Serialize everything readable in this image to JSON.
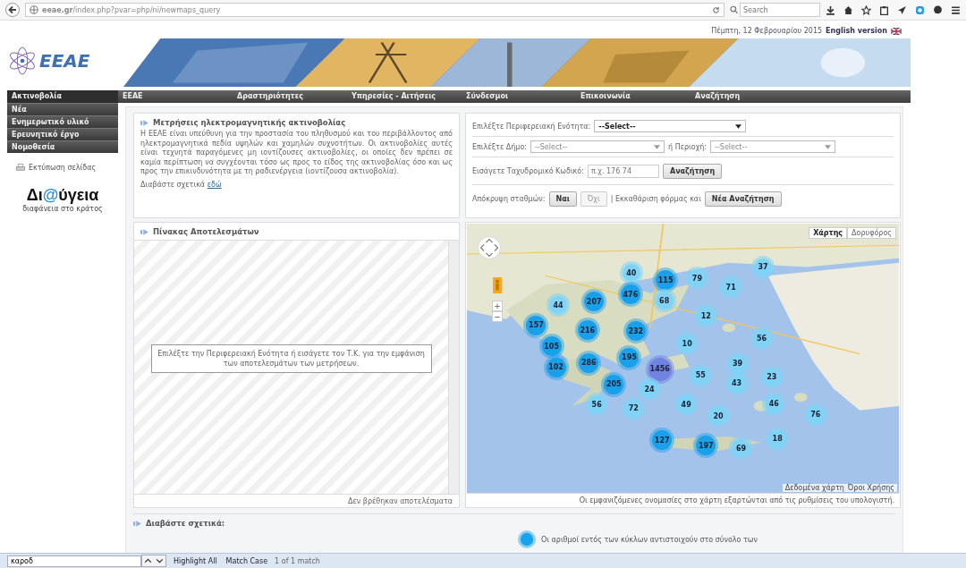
{
  "browser": {
    "url": "**eeae.gr**/index.php?pvar=php/ni/newmaps_query",
    "search_placeholder": "Search"
  },
  "header": {
    "logo": "ΕΕΑΕ",
    "date": "Πέμπτη, 12 Φεβρουαρίου 2015",
    "language_link": "English version"
  },
  "nav": [
    {
      "label": "Ακτινοβολία",
      "selected": true
    },
    {
      "label": "ΕΕΑΕ",
      "selected": false
    },
    {
      "label": "Δραστηριότητες",
      "selected": false
    },
    {
      "label": "Υπηρεσίες - Αιτήσεις",
      "selected": false
    },
    {
      "label": "Σύνδεσμοι",
      "selected": false
    },
    {
      "label": "Επικοινωνία",
      "selected": false
    },
    {
      "label": "Αναζήτηση",
      "selected": false
    }
  ],
  "side_menu": [
    "Νέα",
    "Ενημερωτικό υλικό",
    "Ερευνητικό έργο",
    "Νομοθεσία"
  ],
  "print_link": "Εκτύπωση σελίδας",
  "diavgeia": {
    "parts": [
      "Δι",
      "@",
      "ύγεια"
    ],
    "tagline": "διαφάνεια στο κράτος"
  },
  "intro": {
    "title": "Μετρήσεις ηλεκτρομαγνητικής ακτινοβολίας",
    "text": "Η ΕΕΑΕ είναι υπεύθυνη για την προστασία του πληθυσμού και του περιβάλλοντος από ηλεκτρομαγνητικά πεδία υψηλών και χαμηλών συχνοτήτων. Οι ακτινοβολίες αυτές είναι τεχνητά παραγόμενες μη ιοντίζουσες ακτινοβολίες, οι οποίες δεν πρέπει σε καμία περίπτωση να συγχέονται τόσο ως προς το είδος της ακτινοβολίας όσο και ως προς την επικινδυνότητα με τη ραδιενέργεια (ιοντίζουσα ακτινοβολία).",
    "more": "Διαβάστε σχετικά",
    "more_link": "εδώ"
  },
  "form": {
    "region_label": "Επιλέξτε Περιφερειακή Ενότητα:",
    "region_value": "--Select--",
    "municipality_label": "Επιλέξτε Δήμο:",
    "municipality_value": "--Select--",
    "area_label": "ή Περιοχή:",
    "area_value": "--Select--",
    "postcode_label": "Εισάγετε Ταχυδρομικό Κωδικό:",
    "postcode_placeholder": "π.χ. 176 74",
    "search_button": "Αναζήτηση",
    "hide_label": "Απόκρυψη σταθμών:",
    "hide_options": [
      {
        "label": "Ναι",
        "selected": true
      },
      {
        "label": "Όχι",
        "selected": false
      }
    ],
    "clear_label": "| Εκκαθάριση φόρμας και",
    "new_search_button": "Νέα Αναζήτηση"
  },
  "results": {
    "title": "Πίνακας Αποτελεσμάτων",
    "message": "Επιλέξτε την Περιφερειακή Ενότητα ή εισάγετε τον Τ.Κ. για την εμφάνιση των αποτελεσμάτων των μετρήσεων.",
    "footer": "Δεν βρέθηκαν αποτελέσματα"
  },
  "map": {
    "map_types": [
      {
        "label": "Χάρτης",
        "selected": true
      },
      {
        "label": "Δορυφόρος",
        "selected": false
      }
    ],
    "zoom": [
      "+",
      "−"
    ],
    "attribution": "Δεδομένα χάρτη",
    "terms": "Όροι Χρήσης",
    "note": "Οι εμφανιζόμενες ονομασίες στο χάρτη εξαρτώνται από τις ρυθμίσεις του υπολογιστή.",
    "clusters": [
      {
        "count": "40",
        "kind": "small"
      },
      {
        "count": "115",
        "kind": "medium"
      },
      {
        "count": "79",
        "kind": "small"
      },
      {
        "count": "37",
        "kind": "small"
      },
      {
        "count": "71",
        "kind": "small"
      },
      {
        "count": "476",
        "kind": "medium"
      },
      {
        "count": "68",
        "kind": "small"
      },
      {
        "count": "207",
        "kind": "medium"
      },
      {
        "count": "44",
        "kind": "small"
      },
      {
        "count": "12",
        "kind": "small"
      },
      {
        "count": "157",
        "kind": "medium"
      },
      {
        "count": "216",
        "kind": "medium"
      },
      {
        "count": "232",
        "kind": "medium"
      },
      {
        "count": "10",
        "kind": "small"
      },
      {
        "count": "56",
        "kind": "small"
      },
      {
        "count": "105",
        "kind": "medium"
      },
      {
        "count": "195",
        "kind": "medium"
      },
      {
        "count": "286",
        "kind": "medium"
      },
      {
        "count": "102",
        "kind": "medium"
      },
      {
        "count": "1456",
        "kind": "large"
      },
      {
        "count": "55",
        "kind": "small"
      },
      {
        "count": "39",
        "kind": "small"
      },
      {
        "count": "43",
        "kind": "small"
      },
      {
        "count": "23",
        "kind": "small"
      },
      {
        "count": "205",
        "kind": "medium"
      },
      {
        "count": "24",
        "kind": "small"
      },
      {
        "count": "56",
        "kind": "small"
      },
      {
        "count": "72",
        "kind": "small"
      },
      {
        "count": "49",
        "kind": "small"
      },
      {
        "count": "46",
        "kind": "small"
      },
      {
        "count": "20",
        "kind": "small"
      },
      {
        "count": "76",
        "kind": "small"
      },
      {
        "count": "127",
        "kind": "medium"
      },
      {
        "count": "197",
        "kind": "medium"
      },
      {
        "count": "18",
        "kind": "small"
      },
      {
        "count": "69",
        "kind": "small"
      }
    ]
  },
  "related": {
    "title": "Διαβάστε σχετικά:",
    "legend": "Οι αριθμοί εντός των κύκλων αντιστοιχούν στο σύνολο των"
  },
  "find_bar": {
    "value": "καροδ",
    "highlight_all": "Highlight All",
    "match_case": "Match Case",
    "status": "1 of 1 match"
  }
}
